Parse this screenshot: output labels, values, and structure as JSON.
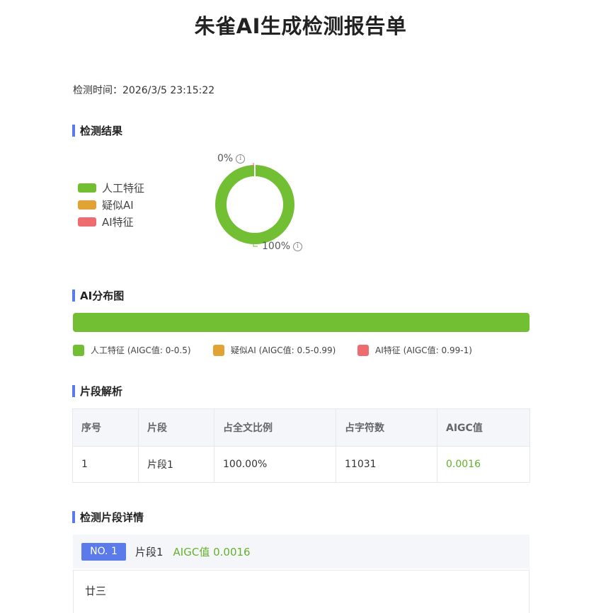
{
  "title": "朱雀AI生成检测报告单",
  "detect_time": {
    "label": "检测时间：",
    "value": "2026/3/5 23:15:22"
  },
  "sections": {
    "result": "检测结果",
    "distribution": "AI分布图",
    "segments": "片段解析",
    "details": "检测片段详情"
  },
  "colors": {
    "human": "#72bf34",
    "suspected": "#e3a234",
    "ai": "#ee6b70",
    "accent": "#5b7bea"
  },
  "chart_data": {
    "type": "pie",
    "categories": [
      "人工特征",
      "疑似AI",
      "AI特征"
    ],
    "values": [
      100,
      0,
      0
    ],
    "labels": {
      "human": "100%",
      "ai": "0%"
    },
    "legend_position": "left"
  },
  "legend": {
    "human": "人工特征",
    "suspected": "疑似AI",
    "ai": "AI特征"
  },
  "distribution": {
    "human_fraction": 1.0,
    "legend": [
      {
        "label": "人工特征 (AIGC值: 0-0.5)",
        "color": "#72bf34"
      },
      {
        "label": "疑似AI (AIGC值: 0.5-0.99)",
        "color": "#e3a234"
      },
      {
        "label": "AI特征 (AIGC值: 0.99-1)",
        "color": "#ee6b70"
      }
    ]
  },
  "table": {
    "headers": [
      "序号",
      "片段",
      "占全文比例",
      "占字符数",
      "AIGC值"
    ],
    "rows": [
      [
        "1",
        "片段1",
        "100.00%",
        "11031",
        "0.0016"
      ]
    ]
  },
  "detail": {
    "badge": "NO. 1",
    "segment": "片段1",
    "aigc": "AIGC值 0.0016",
    "text": "廿三"
  }
}
